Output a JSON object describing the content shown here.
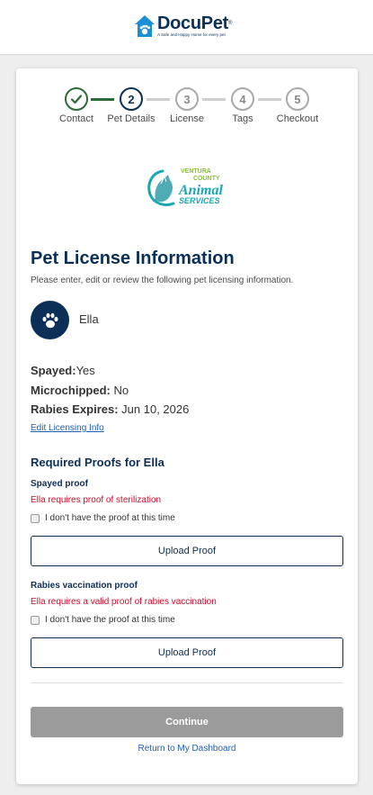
{
  "brand": {
    "name": "DocuPet",
    "trademark": "®",
    "tagline": "A Safe and Happy Home for every pet"
  },
  "stepper": {
    "steps": [
      {
        "number": "",
        "label": "Contact",
        "state": "done"
      },
      {
        "number": "2",
        "label": "Pet Details",
        "state": "current"
      },
      {
        "number": "3",
        "label": "License",
        "state": "todo"
      },
      {
        "number": "4",
        "label": "Tags",
        "state": "todo"
      },
      {
        "number": "5",
        "label": "Checkout",
        "state": "todo"
      }
    ]
  },
  "agency": {
    "line1": "VENTURA",
    "line2": "COUNTY",
    "line3": "Animal",
    "line4": "SERVICES"
  },
  "page": {
    "title": "Pet License Information",
    "subtitle": "Please enter, edit or review the following pet licensing information."
  },
  "pet": {
    "name": "Ella",
    "avatar_icon": "paw-icon"
  },
  "details": {
    "spayed_label": "Spayed:",
    "spayed_value": "Yes",
    "microchipped_label": "Microchipped:",
    "microchipped_value": "No",
    "rabies_label": "Rabies Expires:",
    "rabies_value": "Jun 10, 2026",
    "edit_link": "Edit Licensing Info"
  },
  "proofs": {
    "heading": "Required Proofs for Ella",
    "items": [
      {
        "title": "Spayed proof",
        "requirement": "Ella requires proof of sterilization",
        "checkbox_label": "I don't have the proof at this time",
        "upload_label": "Upload Proof"
      },
      {
        "title": "Rabies vaccination proof",
        "requirement": "Ella requires a valid proof of rabies vaccination",
        "checkbox_label": "I don't have the proof at this time",
        "upload_label": "Upload Proof"
      }
    ]
  },
  "actions": {
    "continue_label": "Continue",
    "dashboard_link": "Return to My Dashboard"
  },
  "colors": {
    "brand_navy": "#0c2f57",
    "done_green": "#2e6b3a",
    "error_red": "#c8102e",
    "link_blue": "#1f5fb3",
    "disabled_gray": "#9b9b9b"
  }
}
